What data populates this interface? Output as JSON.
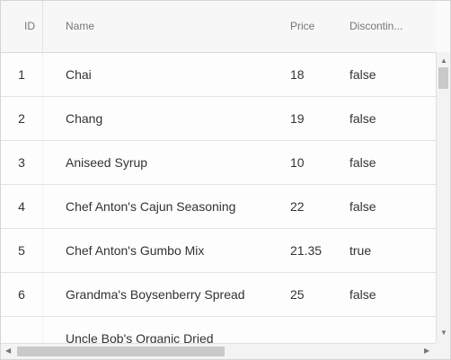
{
  "columns": {
    "id": "ID",
    "name": "Name",
    "price": "Price",
    "discontinued": "Discontin..."
  },
  "rows": [
    {
      "id": "1",
      "name": "Chai",
      "price": "18",
      "discontinued": "false"
    },
    {
      "id": "2",
      "name": "Chang",
      "price": "19",
      "discontinued": "false"
    },
    {
      "id": "3",
      "name": "Aniseed Syrup",
      "price": "10",
      "discontinued": "false"
    },
    {
      "id": "4",
      "name": "Chef Anton's Cajun Seasoning",
      "price": "22",
      "discontinued": "false"
    },
    {
      "id": "5",
      "name": "Chef Anton's Gumbo Mix",
      "price": "21.35",
      "discontinued": "true"
    },
    {
      "id": "6",
      "name": "Grandma's Boysenberry Spread",
      "price": "25",
      "discontinued": "false"
    },
    {
      "id": "",
      "name": "Uncle Bob's Organic Dried",
      "price": "",
      "discontinued": ""
    }
  ],
  "scrollbars": {
    "up": "▲",
    "down": "▼",
    "left": "◀",
    "right": "▶"
  }
}
